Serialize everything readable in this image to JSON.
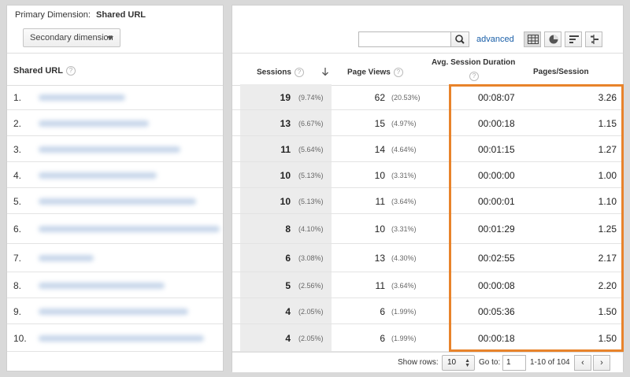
{
  "left_panel": {
    "primary_dimension_label": "Primary Dimension:",
    "primary_dimension_value": "Shared URL",
    "secondary_dimension_label": "Secondary dimension",
    "column_header": "Shared URL",
    "row_numbers": [
      "1.",
      "2.",
      "3.",
      "4.",
      "5.",
      "6.",
      "7.",
      "8.",
      "9.",
      "10."
    ]
  },
  "toolbar": {
    "search_value": "",
    "search_placeholder": "",
    "advanced_label": "advanced",
    "view_buttons": [
      "table-view-icon",
      "pie-view-icon",
      "performance-view-icon",
      "comparison-view-icon"
    ]
  },
  "table": {
    "headers": {
      "sessions": "Sessions",
      "page_views": "Page Views",
      "avg_session_duration": "Avg. Session Duration",
      "pages_per_session": "Pages/Session"
    },
    "sort_icon": "sort-arrow-down-icon",
    "rows": [
      {
        "sessions": "19",
        "sessions_pct": "(9.74%)",
        "page_views": "62",
        "page_views_pct": "(20.53%)",
        "duration": "00:08:07",
        "pages_session": "3.26"
      },
      {
        "sessions": "13",
        "sessions_pct": "(6.67%)",
        "page_views": "15",
        "page_views_pct": "(4.97%)",
        "duration": "00:00:18",
        "pages_session": "1.15"
      },
      {
        "sessions": "11",
        "sessions_pct": "(5.64%)",
        "page_views": "14",
        "page_views_pct": "(4.64%)",
        "duration": "00:01:15",
        "pages_session": "1.27"
      },
      {
        "sessions": "10",
        "sessions_pct": "(5.13%)",
        "page_views": "10",
        "page_views_pct": "(3.31%)",
        "duration": "00:00:00",
        "pages_session": "1.00"
      },
      {
        "sessions": "10",
        "sessions_pct": "(5.13%)",
        "page_views": "11",
        "page_views_pct": "(3.64%)",
        "duration": "00:00:01",
        "pages_session": "1.10"
      },
      {
        "sessions": "8",
        "sessions_pct": "(4.10%)",
        "page_views": "10",
        "page_views_pct": "(3.31%)",
        "duration": "00:01:29",
        "pages_session": "1.25"
      },
      {
        "sessions": "6",
        "sessions_pct": "(3.08%)",
        "page_views": "13",
        "page_views_pct": "(4.30%)",
        "duration": "00:02:55",
        "pages_session": "2.17"
      },
      {
        "sessions": "5",
        "sessions_pct": "(2.56%)",
        "page_views": "11",
        "page_views_pct": "(3.64%)",
        "duration": "00:00:08",
        "pages_session": "2.20"
      },
      {
        "sessions": "4",
        "sessions_pct": "(2.05%)",
        "page_views": "6",
        "page_views_pct": "(1.99%)",
        "duration": "00:05:36",
        "pages_session": "1.50"
      },
      {
        "sessions": "4",
        "sessions_pct": "(2.05%)",
        "page_views": "6",
        "page_views_pct": "(1.99%)",
        "duration": "00:00:18",
        "pages_session": "1.50"
      }
    ],
    "highlight_color": "#e8832b"
  },
  "footer": {
    "show_rows_label": "Show rows:",
    "show_rows_value": "10",
    "goto_label": "Go to:",
    "goto_value": "1",
    "range_text": "1-10 of 104",
    "prev_label": "‹",
    "next_label": "›"
  }
}
